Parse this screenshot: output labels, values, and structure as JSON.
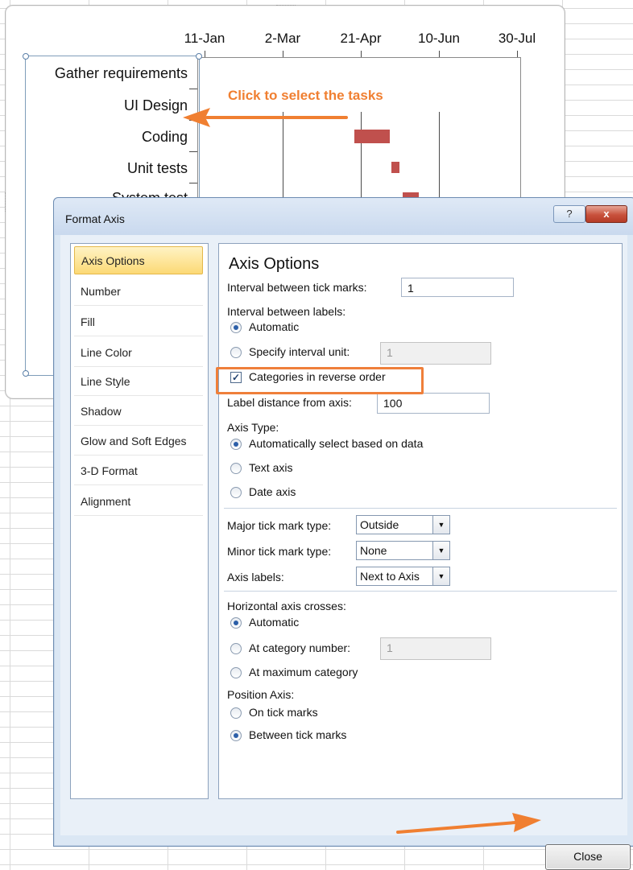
{
  "chart": {
    "x_labels": [
      "11-Jan",
      "2-Mar",
      "21-Apr",
      "10-Jun",
      "30-Jul"
    ],
    "tasks": [
      "Gather requirements",
      "UI Design",
      "Coding",
      "Unit tests",
      "System test"
    ],
    "callout": "Click to select the tasks",
    "bar_color": "#c0504d",
    "accent_color": "#f07f31"
  },
  "dialog": {
    "title": "Format Axis",
    "help_glyph": "?",
    "close_glyph": "x",
    "nav_items": [
      "Axis Options",
      "Number",
      "Fill",
      "Line Color",
      "Line Style",
      "Shadow",
      "Glow and Soft Edges",
      "3-D Format",
      "Alignment"
    ],
    "panel": {
      "title": "Axis Options",
      "interval_tick_label": "Interval between tick marks:",
      "interval_tick_value": "1",
      "interval_labels_label": "Interval between labels:",
      "automatic_label": "Automatic",
      "specify_interval_label": "Specify interval unit:",
      "specify_interval_value": "1",
      "reverse_order_label": "Categories in reverse order",
      "label_distance_label": "Label distance from axis:",
      "label_distance_value": "100",
      "axis_type_label": "Axis Type:",
      "auto_select_label": "Automatically select based on data",
      "text_axis_label": "Text axis",
      "date_axis_label": "Date axis",
      "major_tick_label": "Major tick mark type:",
      "major_tick_value": "Outside",
      "minor_tick_label": "Minor tick mark type:",
      "minor_tick_value": "None",
      "axis_labels_label": "Axis labels:",
      "axis_labels_value": "Next to Axis",
      "h_axis_crosses_label": "Horizontal axis crosses:",
      "crosses_auto_label": "Automatic",
      "crosses_category_label": "At category number:",
      "crosses_category_value": "1",
      "crosses_max_label": "At maximum category",
      "position_axis_label": "Position Axis:",
      "on_tick_label": "On tick marks",
      "between_tick_label": "Between tick marks",
      "reverse_order_checked": true,
      "interval_labels_choice": "Automatic",
      "axis_type_choice": "Automatically select based on data",
      "crosses_choice": "Automatic",
      "position_axis_choice": "Between tick marks"
    },
    "close_button": "Close"
  }
}
